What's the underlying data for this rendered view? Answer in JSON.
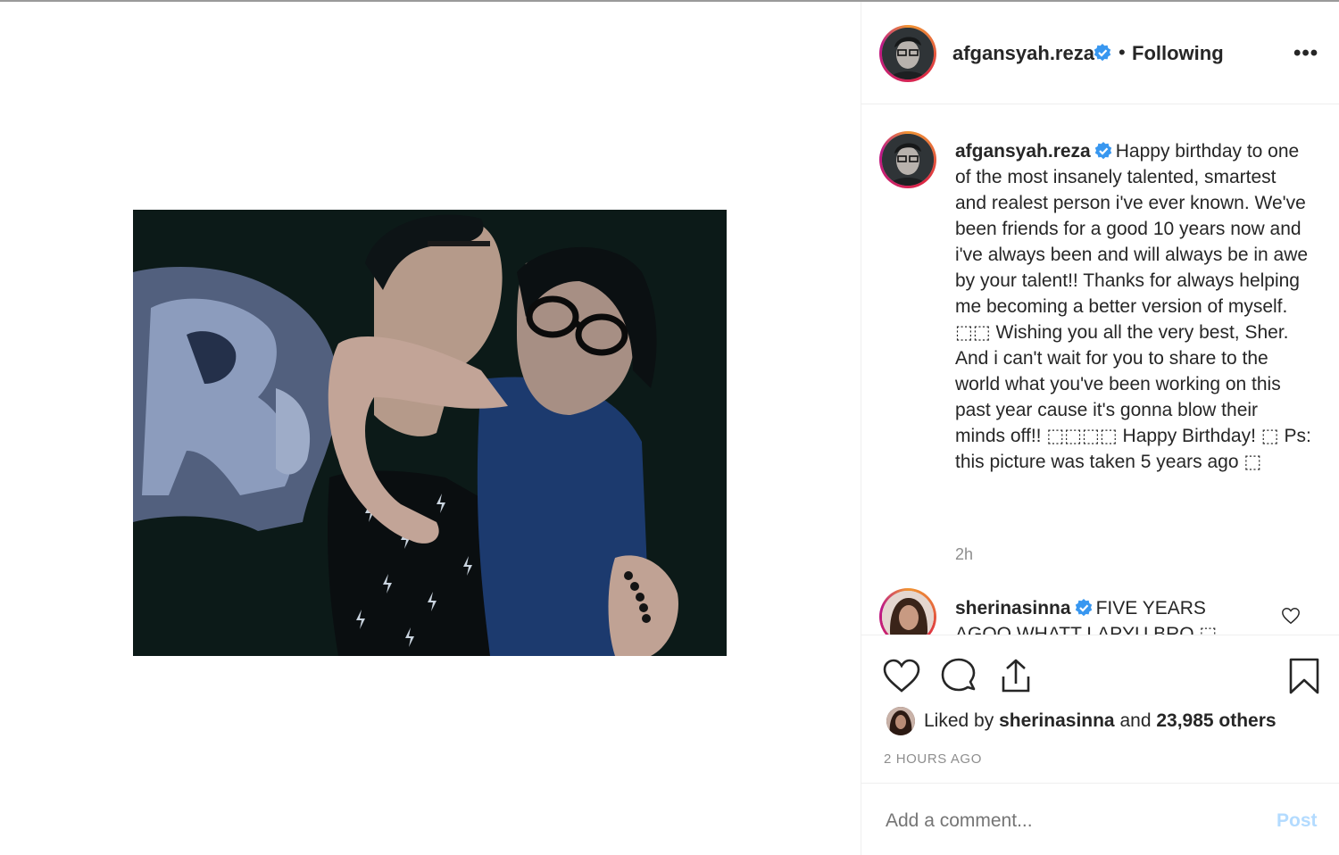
{
  "post": {
    "username": "afgansyah.reza",
    "separator": "•",
    "follow_status": "Following",
    "more_label": "•••"
  },
  "caption": {
    "username": "afgansyah.reza",
    "text": "Happy birthday to one of the most insanely talented, smartest and realest person i've ever known. We've been friends for a good 10 years now and i've always been and will always be in awe by your talent!! Thanks for always helping me becoming a better version of myself. ⬚⬚ Wishing you all the very best, Sher. And i can't wait for you to share to the world what you've been working on this past year cause it's gonna blow their minds off!! ⬚⬚⬚⬚ Happy Birthday! ⬚ Ps: this picture was taken 5 years ago ⬚",
    "time": "2h"
  },
  "comment": {
    "username": "sherinasinna",
    "text": "FIVE YEARS AGOO WHATT LAPYU BRO ⬚"
  },
  "likes": {
    "prefix": "Liked by ",
    "user": "sherinasinna",
    "middle": " and ",
    "others": "23,985 others"
  },
  "timestamp": "2 HOURS AGO",
  "comment_box": {
    "placeholder": "Add a comment...",
    "post_label": "Post"
  },
  "icons": {
    "like": "heart-icon",
    "comment": "comment-icon",
    "share": "share-icon",
    "save": "bookmark-icon",
    "verified": "verified-badge-icon"
  },
  "colors": {
    "verified_blue": "#3897f0",
    "post_disabled": "#b3dbff",
    "muted": "#8e8e8e"
  }
}
